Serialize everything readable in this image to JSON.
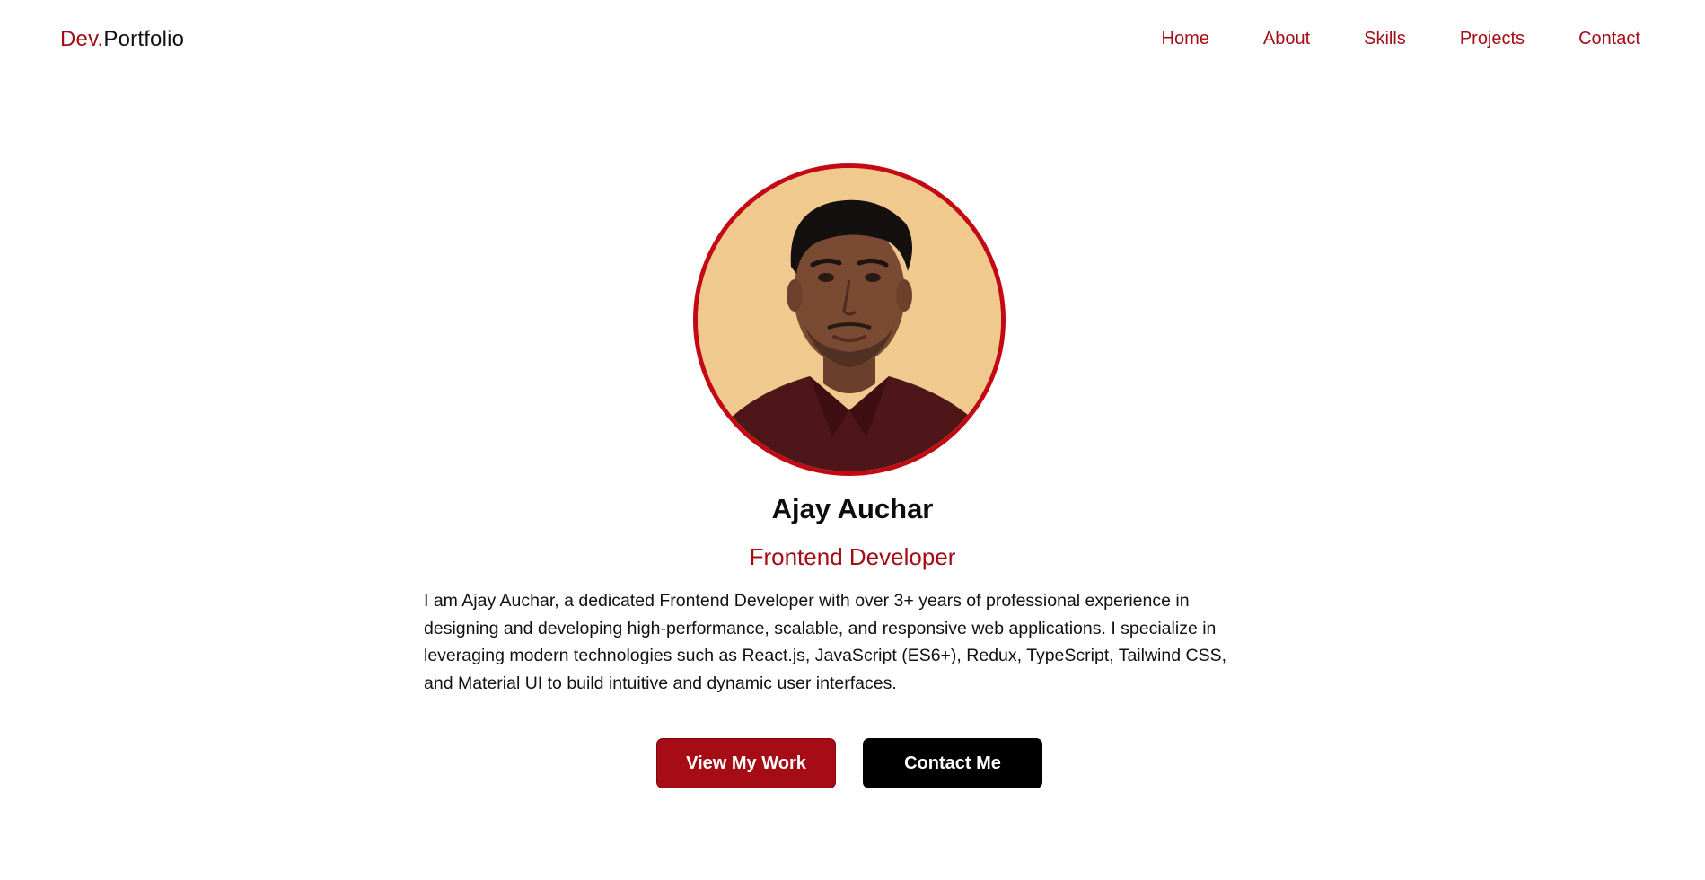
{
  "nav": {
    "logo_accent": "Dev.",
    "logo_rest": "Portfolio",
    "links": [
      "Home",
      "About",
      "Skills",
      "Projects",
      "Contact"
    ]
  },
  "hero": {
    "name": "Ajay Auchar",
    "role": "Frontend Developer",
    "bio": "I am Ajay Auchar, a dedicated Frontend Developer with over 3+ years of professional experience in designing and developing high-performance, scalable, and responsive web applications. I specialize in leveraging modern technologies such as React.js, JavaScript (ES6+), Redux, TypeScript, Tailwind CSS, and Material UI to build intuitive and dynamic user interfaces.",
    "primary_button": "View My Work",
    "secondary_button": "Contact Me"
  },
  "colors": {
    "accent": "#a50c16",
    "avatar_border": "#c30a14",
    "text": "#111111",
    "background": "#ffffff",
    "secondary_button": "#000000"
  }
}
